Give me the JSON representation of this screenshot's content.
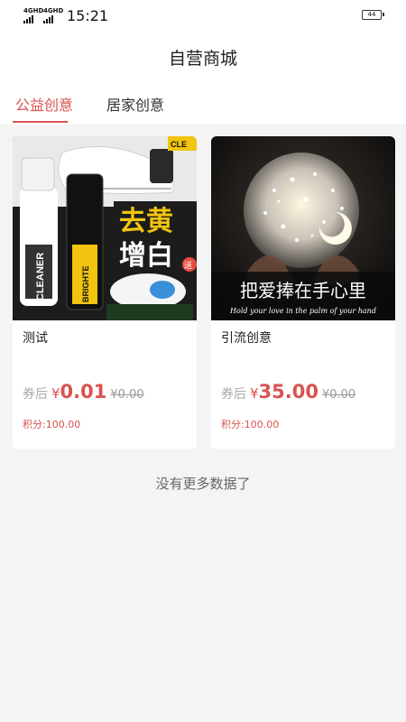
{
  "status_bar": {
    "signal1": "4GHD",
    "signal2": "4GHD",
    "time": "15:21",
    "battery": "44"
  },
  "header": {
    "title": "自营商城"
  },
  "tabs": [
    {
      "label": "公益创意",
      "active": true
    },
    {
      "label": "居家创意",
      "active": false
    }
  ],
  "products": [
    {
      "title": "测试",
      "coupon_label": "券后",
      "currency": "¥",
      "price": "0.01",
      "original_price": "¥0.00",
      "points": "积分:100.00",
      "image": {
        "line1": "去黄",
        "line2": "增白",
        "bottle_text": "CLEANER",
        "bottle_text2": "BRIGHTE",
        "badge": "送",
        "tag": "CLE"
      }
    },
    {
      "title": "引流创意",
      "coupon_label": "券后",
      "currency": "¥",
      "price": "35.00",
      "original_price": "¥0.00",
      "points": "积分:100.00",
      "image": {
        "caption": "把爱捧在手心里",
        "subcaption": "Hold your love in the palm of your hand"
      }
    }
  ],
  "footer": {
    "no_more": "没有更多数据了"
  },
  "colors": {
    "accent": "#d9534f",
    "background": "#f4f4f4",
    "card": "#ffffff"
  }
}
